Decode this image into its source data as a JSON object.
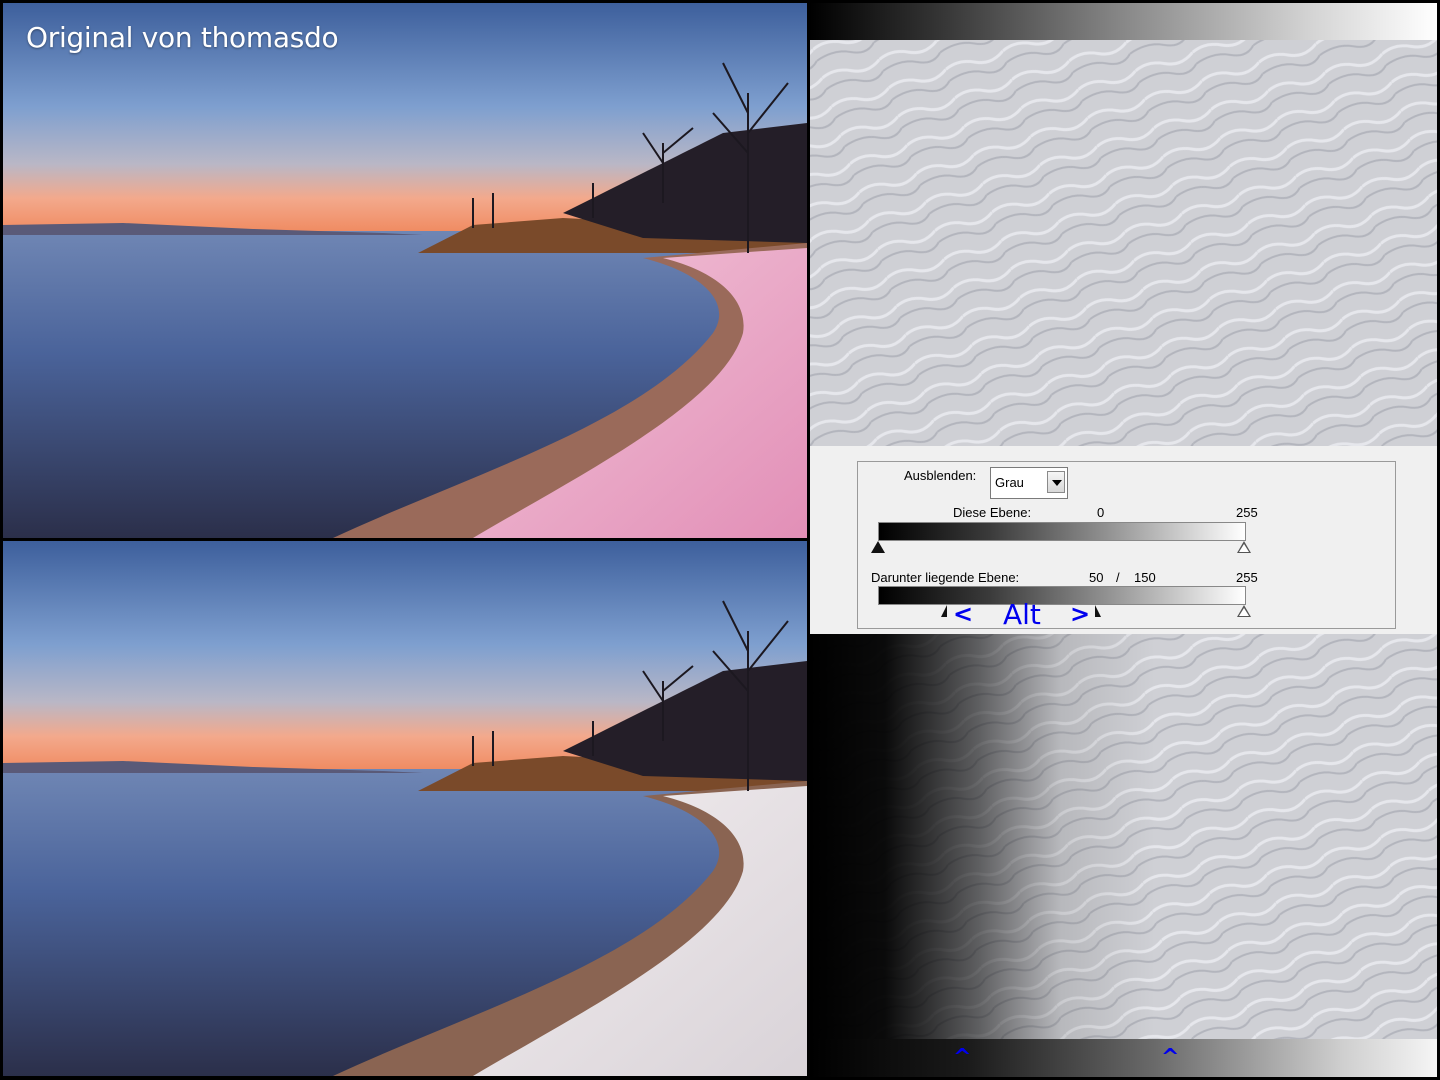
{
  "photos": {
    "top_caption": "Original von thomasdo"
  },
  "blend_panel": {
    "ausblenden_label": "Ausblenden:",
    "ausblenden_value": "Grau",
    "this_layer": {
      "label": "Diese Ebene:",
      "black_value": "0",
      "white_value": "255"
    },
    "underlying_layer": {
      "label": "Darunter liegende Ebene:",
      "black_low": "50",
      "separator": "/",
      "black_high": "150",
      "white_value": "255"
    },
    "alt_hint": {
      "left_arrow": "<",
      "text": "Alt",
      "right_arrow": ">"
    }
  },
  "markers": {
    "caret_left": "^",
    "caret_right": "^"
  },
  "colors": {
    "hint_blue": "#0000ee",
    "panel_bg": "#f0f0f0"
  }
}
